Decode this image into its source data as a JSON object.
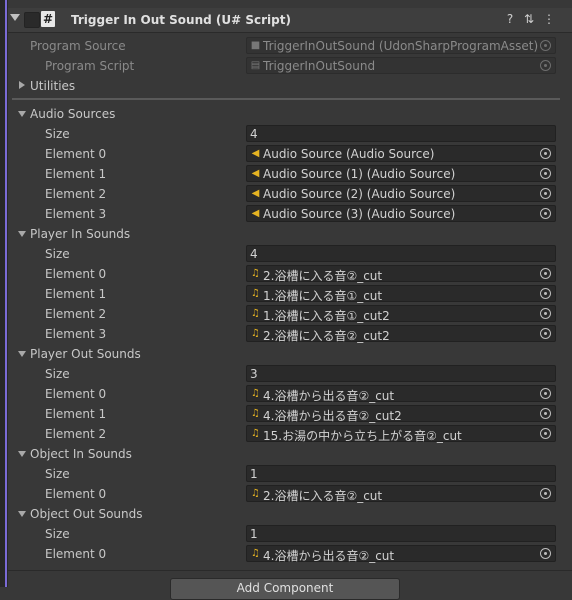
{
  "header": {
    "title": "Trigger In Out Sound (U# Script)",
    "icons": [
      "help-icon",
      "presets-icon",
      "kebab-menu-icon"
    ]
  },
  "program_source": {
    "label": "Program Source",
    "value": "TriggerInOutSound (UdonSharpProgramAsset)"
  },
  "program_script": {
    "label": "Program Script",
    "value": "TriggerInOutSound"
  },
  "utilities_label": "Utilities",
  "audio_sources": {
    "label": "Audio Sources",
    "size_label": "Size",
    "size": "4",
    "elements": [
      {
        "label": "Element 0",
        "value": "Audio Source (Audio Source)"
      },
      {
        "label": "Element 1",
        "value": "Audio Source (1) (Audio Source)"
      },
      {
        "label": "Element 2",
        "value": "Audio Source (2) (Audio Source)"
      },
      {
        "label": "Element 3",
        "value": "Audio Source (3) (Audio Source)"
      }
    ]
  },
  "player_in_sounds": {
    "label": "Player In Sounds",
    "size_label": "Size",
    "size": "4",
    "elements": [
      {
        "label": "Element 0",
        "value": "2.浴槽に入る音②_cut"
      },
      {
        "label": "Element 1",
        "value": "1.浴槽に入る音①_cut"
      },
      {
        "label": "Element 2",
        "value": "1.浴槽に入る音①_cut2"
      },
      {
        "label": "Element 3",
        "value": "2.浴槽に入る音②_cut2"
      }
    ]
  },
  "player_out_sounds": {
    "label": "Player Out Sounds",
    "size_label": "Size",
    "size": "3",
    "elements": [
      {
        "label": "Element 0",
        "value": "4.浴槽から出る音②_cut"
      },
      {
        "label": "Element 1",
        "value": "4.浴槽から出る音②_cut2"
      },
      {
        "label": "Element 2",
        "value": "15.お湯の中から立ち上がる音②_cut"
      }
    ]
  },
  "object_in_sounds": {
    "label": "Object In Sounds",
    "size_label": "Size",
    "size": "1",
    "elements": [
      {
        "label": "Element 0",
        "value": "2.浴槽に入る音②_cut"
      }
    ]
  },
  "object_out_sounds": {
    "label": "Object Out Sounds",
    "size_label": "Size",
    "size": "1",
    "elements": [
      {
        "label": "Element 0",
        "value": "4.浴槽から出る音②_cut"
      }
    ]
  },
  "add_component_label": "Add Component",
  "colors": {
    "accent_stripe": "#7b6bd6",
    "asset_icon": "#e6b422",
    "background": "#383838"
  }
}
